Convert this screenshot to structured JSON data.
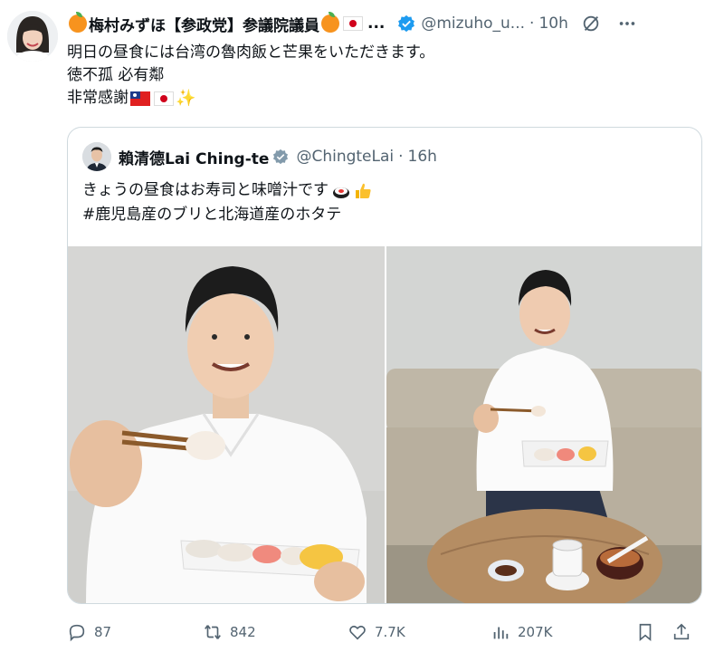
{
  "tweet": {
    "author_name": "梅村みずほ【参政党】参議院議員",
    "handle": "@mizuho_u...",
    "time": "10h",
    "lines": [
      "明日の昼食には台湾の魯肉飯と芒果をいただきます。",
      "徳不孤 必有鄰",
      "非常感謝"
    ]
  },
  "quoted": {
    "author_name": "賴清德Lai Ching-te",
    "handle": "@ChingteLai",
    "time": "16h",
    "lines": [
      "きょうの昼食はお寿司と味噌汁です",
      "#鹿児島産のブリと北海道産のホタテ"
    ]
  },
  "actions": {
    "replies": "87",
    "reposts": "842",
    "likes": "7.7K",
    "views": "207K"
  },
  "colors": {
    "text": "#0f1419",
    "secondary": "#536471",
    "verified_blue": "#1d9bf0",
    "border": "#cfd9de"
  },
  "icons": [
    "orange-emoji",
    "japan-flag",
    "taiwan-flag",
    "sparkles",
    "sushi-emoji",
    "thumbs-up-emoji",
    "verified-badge",
    "grok-icon",
    "more-icon",
    "reply-icon",
    "repost-icon",
    "like-icon",
    "views-icon",
    "bookmark-icon",
    "share-icon"
  ]
}
